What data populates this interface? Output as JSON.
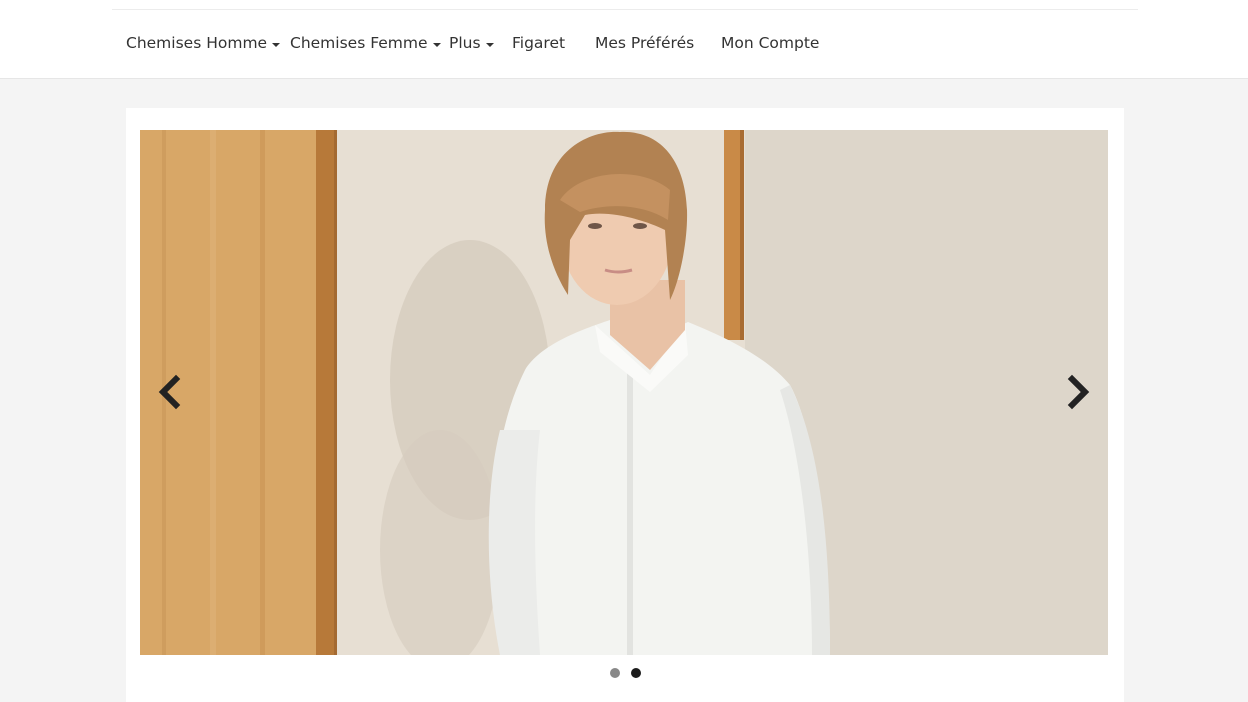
{
  "nav": {
    "items": [
      {
        "label": "Chemises Homme",
        "dropdown": true
      },
      {
        "label": "Chemises Femme",
        "dropdown": true
      },
      {
        "label": "Plus",
        "dropdown": true
      },
      {
        "label": "Figaret",
        "dropdown": false
      },
      {
        "label": "Mes Préférés",
        "dropdown": false
      },
      {
        "label": "Mon Compte",
        "dropdown": false
      }
    ]
  },
  "carousel": {
    "prev_icon": "chevron-left-icon",
    "next_icon": "chevron-right-icon",
    "slide_count": 2,
    "active_index": 1
  },
  "colors": {
    "nav_text": "#333333",
    "page_background": "#f4f4f4",
    "indicator_active": "#1c1c1c",
    "indicator_inactive": "#888888"
  }
}
